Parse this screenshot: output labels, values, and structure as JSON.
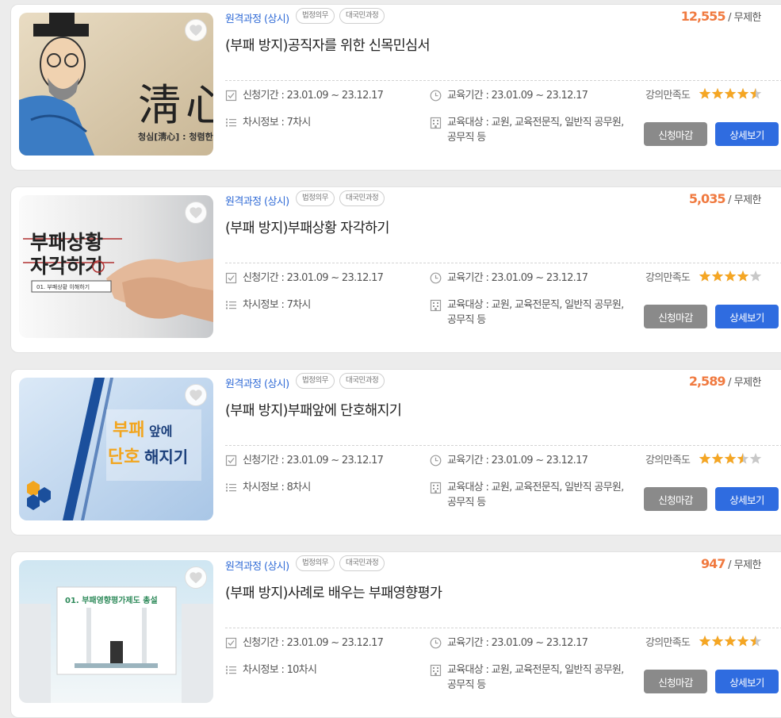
{
  "courses": [
    {
      "category": "원격과정 (상시)",
      "badges": [
        "법정의무",
        "대국민과정"
      ],
      "count": "12,555",
      "count_suffix": "/ 무제한",
      "title": "(부패 방지)공직자를 위한 신목민심서",
      "apply_period": "신청기간 : 23.01.09 ~ 23.12.17",
      "sessions": "차시정보 :  7차시",
      "edu_period": "교육기간 : 23.01.09 ~ 23.12.17",
      "edu_target": "교육대상 : 교원, 교육전문직, 일반직 공무원, 공무직 등",
      "satisfaction_label": "강의만족도",
      "rating": 4.5,
      "closed_label": "신청마감",
      "detail_label": "상세보기",
      "thumb": {
        "kind": "scholar",
        "text_big": "淸",
        "text_big2": "心",
        "caption": "청심[淸心] : 청렴한"
      }
    },
    {
      "category": "원격과정 (상시)",
      "badges": [
        "법정의무",
        "대국민과정"
      ],
      "count": "5,035",
      "count_suffix": "/ 무제한",
      "title": "(부패 방지)부패상황 자각하기",
      "apply_period": "신청기간 : 23.01.09 ~ 23.12.17",
      "sessions": "차시정보 :  7차시",
      "edu_period": "교육기간 : 23.01.09 ~ 23.12.17",
      "edu_target": "교육대상 : 교원, 교육전문직, 일반직 공무원, 공무직 등",
      "satisfaction_label": "강의만족도",
      "rating": 4.0,
      "closed_label": "신청마감",
      "detail_label": "상세보기",
      "thumb": {
        "kind": "handshake",
        "line1": "부패상황",
        "line2": "자각하기",
        "caption": "01. 부패상황 이해하기"
      }
    },
    {
      "category": "원격과정 (상시)",
      "badges": [
        "법정의무",
        "대국민과정"
      ],
      "count": "2,589",
      "count_suffix": "/ 무제한",
      "title": "(부패 방지)부패앞에 단호해지기",
      "apply_period": "신청기간 : 23.01.09 ~ 23.12.17",
      "sessions": "차시정보 :  8차시",
      "edu_period": "교육기간 : 23.01.09 ~ 23.12.17",
      "edu_target": "교육대상 : 교원, 교육전문직, 일반직 공무원, 공무직 등",
      "satisfaction_label": "강의만족도",
      "rating": 3.5,
      "closed_label": "신청마감",
      "detail_label": "상세보기",
      "thumb": {
        "kind": "blue",
        "line1a": "부패",
        "line1b": "앞에",
        "line2a": "단호",
        "line2b": "해지기"
      }
    },
    {
      "category": "원격과정 (상시)",
      "badges": [
        "법정의무",
        "대국민과정"
      ],
      "count": "947",
      "count_suffix": "/ 무제한",
      "title": "(부패 방지)사례로 배우는 부패영향평가",
      "apply_period": "신청기간 : 23.01.09 ~ 23.12.17",
      "sessions": "차시정보 :  10차시",
      "edu_period": "교육기간 : 23.01.09 ~ 23.12.17",
      "edu_target": "교육대상 : 교원, 교육전문직, 일반직 공무원, 공무직 등",
      "satisfaction_label": "강의만족도",
      "rating": 4.5,
      "closed_label": "신청마감",
      "detail_label": "상세보기",
      "thumb": {
        "kind": "office",
        "caption": "01. 부패영향평가제도 총설"
      }
    }
  ],
  "colors": {
    "accent": "#2f6ad6",
    "count": "#f07a40",
    "star": "#f5a623",
    "star_empty": "#c8c8c8",
    "btn_closed": "#8a8a8a",
    "btn_detail": "#2f6ce0"
  },
  "icons": {
    "wishlist": "heart-icon",
    "apply": "checkbox-icon",
    "sessions": "list-icon",
    "edu": "clock-icon",
    "target": "building-icon",
    "rating": "star-icon"
  }
}
